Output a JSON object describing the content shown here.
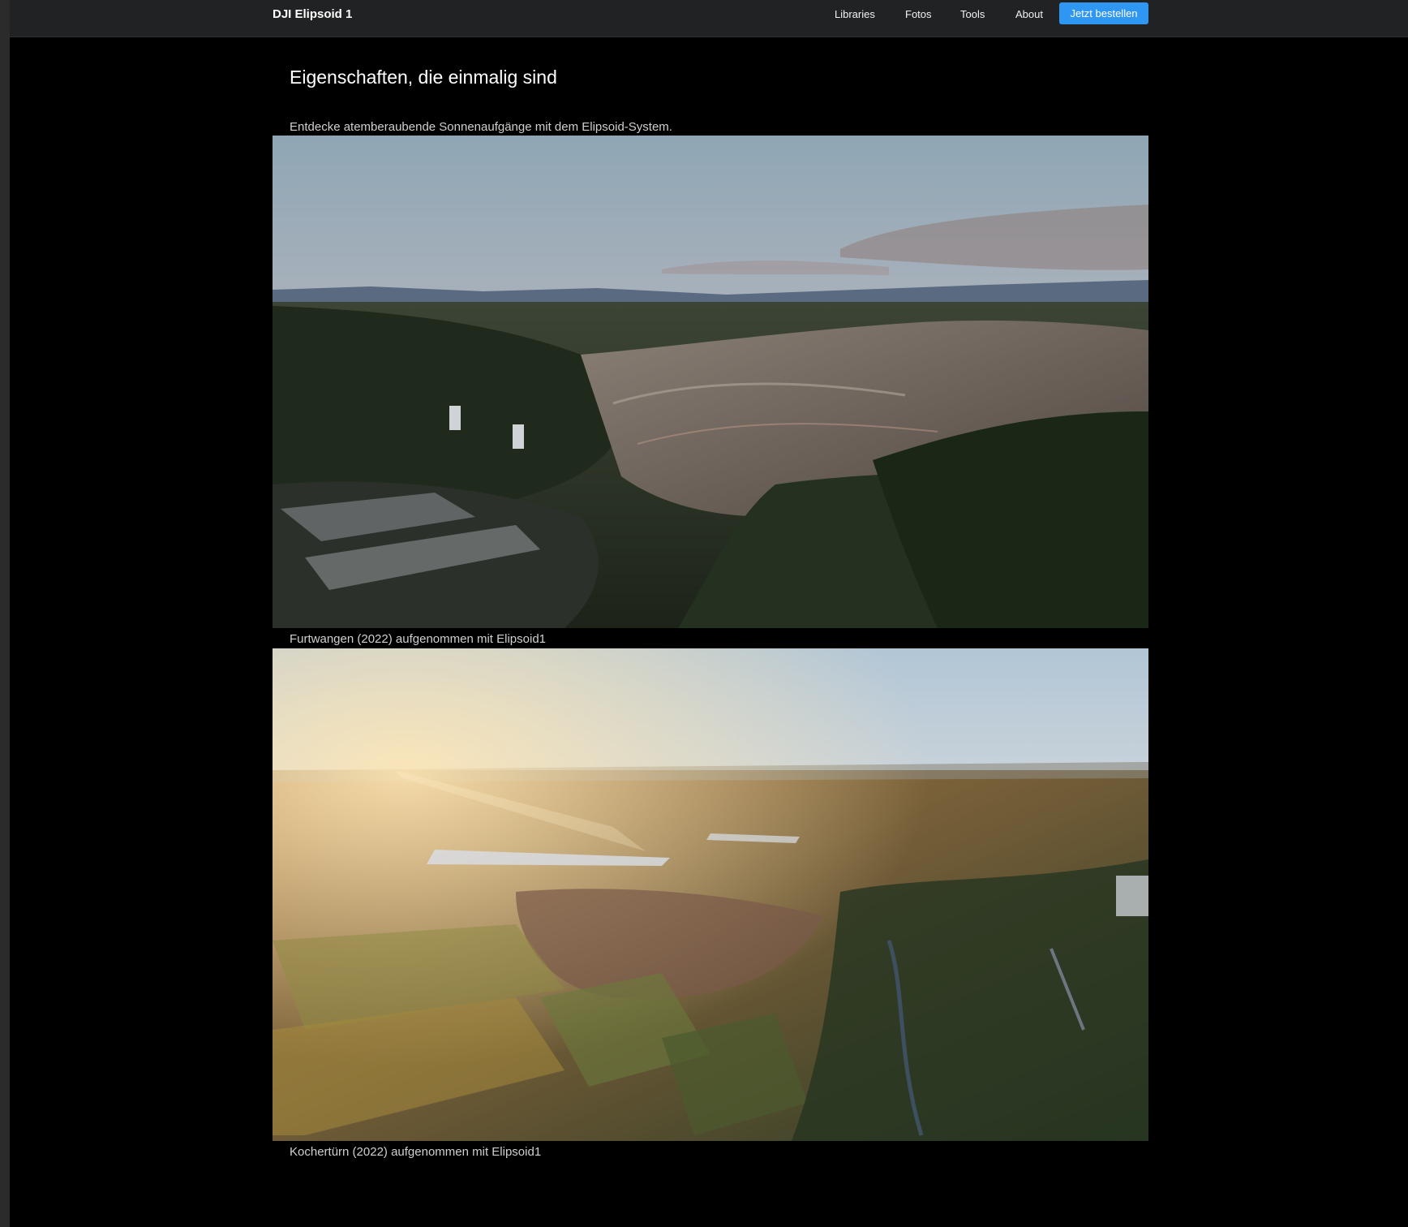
{
  "nav": {
    "brand": "DJI Elipsoid 1",
    "items": [
      "Libraries",
      "Fotos",
      "Tools",
      "About"
    ],
    "cta": "Jetzt bestellen"
  },
  "main": {
    "title": "Eigenschaften, die einmalig sind",
    "intro": "Entdecke atemberaubende Sonnenaufgänge mit dem Elipsoid-System.",
    "photos": [
      {
        "caption": "Furtwangen (2022) aufgenommen mit Elipsoid1",
        "scene": "aerial-town-valley-sunset"
      },
      {
        "caption": "Kochertürn (2022) aufgenommen mit Elipsoid1",
        "scene": "aerial-fields-sunrise"
      }
    ]
  },
  "colors": {
    "page_bg": "#000000",
    "navbar_bg": "#212223",
    "accent": "#2f96f1",
    "text": "#ffffff",
    "muted_text": "#cfcfcf"
  }
}
